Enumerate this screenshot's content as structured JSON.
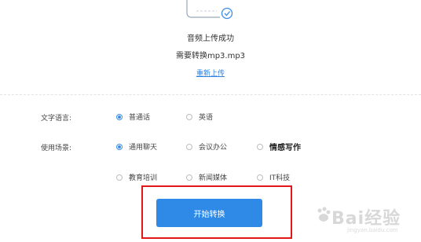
{
  "upload": {
    "icon": "audio-upload-success-icon",
    "status_title": "音频上传成功",
    "file_info": "需要转换mp3.mp3",
    "reupload_label": "重新上传"
  },
  "language": {
    "label": "文字语言:",
    "options": [
      "普通话",
      "英语"
    ],
    "selected": "普通话"
  },
  "scene": {
    "label": "使用场景:",
    "options": [
      "通用聊天",
      "会议办公",
      "情感写作",
      "教育培训",
      "新闻媒体",
      "IT科技"
    ],
    "selected": "通用聊天"
  },
  "start_button_label": "开始转换",
  "colors": {
    "accent": "#2e8ae6",
    "link": "#2f7fe0",
    "highlight": "#e21818"
  },
  "watermark": {
    "text": "Bai经验",
    "sub": "jingyan.baidu.com"
  }
}
